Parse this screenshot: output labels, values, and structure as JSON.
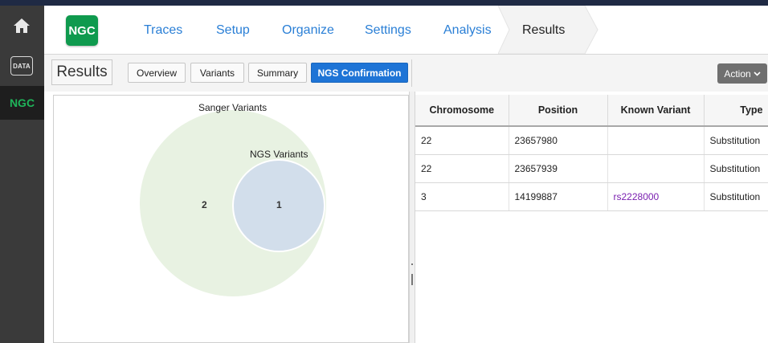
{
  "rail": {
    "items": [
      {
        "name": "home",
        "icon": "home-icon"
      },
      {
        "name": "data",
        "label": "DATA"
      },
      {
        "name": "ngc",
        "label": "NGC"
      }
    ]
  },
  "nav": {
    "logo": "NGC",
    "tabs": [
      {
        "label": "Traces"
      },
      {
        "label": "Setup"
      },
      {
        "label": "Organize"
      },
      {
        "label": "Settings"
      },
      {
        "label": "Analysis"
      },
      {
        "label": "Results"
      }
    ],
    "active_tab": "Results",
    "colors": {
      "link": "#2a7fd6",
      "brand": "#0f9a4e"
    }
  },
  "subbar": {
    "title": "Results",
    "buttons": [
      {
        "label": "Overview"
      },
      {
        "label": "Variants"
      },
      {
        "label": "Summary"
      },
      {
        "label": "NGS Confirmation"
      }
    ],
    "active_button": "NGS Confirmation",
    "action_label": "Action",
    "action_icon": "chevron-down-icon"
  },
  "venn": {
    "set_a_label": "Sanger Variants",
    "set_b_label": "NGS Variants",
    "only_a_count": "2",
    "overlap_count": "1",
    "colors": {
      "set_a": "#e8f2e2",
      "set_b": "#d2deeb"
    }
  },
  "table": {
    "columns": [
      "Chromosome",
      "Position",
      "Known Variant",
      "Type"
    ],
    "rows": [
      [
        "22",
        "23657980",
        "",
        "Substitution"
      ],
      [
        "22",
        "23657939",
        "",
        "Substitution"
      ],
      [
        "3",
        "14199887",
        "rs2228000",
        "Substitution"
      ]
    ],
    "link_color": "#7a1fb0"
  }
}
